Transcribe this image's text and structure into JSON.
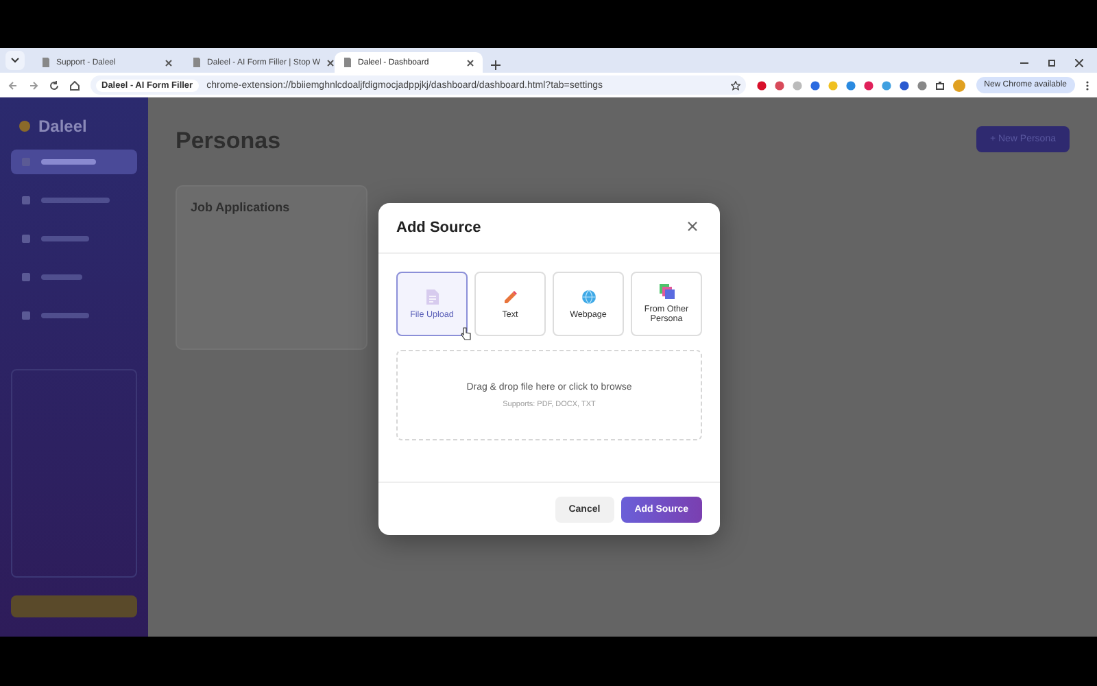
{
  "browser": {
    "tabs": [
      {
        "title": "Support - Daleel",
        "selected": false
      },
      {
        "title": "Daleel - AI Form Filler | Stop W",
        "selected": false
      },
      {
        "title": "Daleel - Dashboard",
        "selected": true
      }
    ],
    "site_chip": "Daleel - AI Form Filler",
    "url": "chrome-extension://bbiiemghnlcdoaljfdigmocjadppjkj/dashboard/dashboard.html?tab=settings",
    "update_button": "New Chrome available"
  },
  "app": {
    "name": "Daleel",
    "nav": [
      {
        "selected": true
      },
      {
        "selected": false
      },
      {
        "selected": false
      },
      {
        "selected": false
      },
      {
        "selected": false
      }
    ],
    "page_title": "Personas",
    "new_persona_button": "+ New Persona",
    "card_title": "Job Applications"
  },
  "dialog": {
    "title": "Add Source",
    "options": [
      {
        "kind": "file",
        "label": "File Upload",
        "selected": true
      },
      {
        "kind": "text",
        "label": "Text",
        "selected": false
      },
      {
        "kind": "web",
        "label": "Webpage",
        "selected": false
      },
      {
        "kind": "persona",
        "label": "From Other Persona",
        "selected": false
      }
    ],
    "dropzone": {
      "text": "Drag & drop file here or click to browse",
      "hint": "Supports: PDF, DOCX, TXT"
    },
    "cancel_button": "Cancel",
    "submit_button": "Add Source"
  }
}
